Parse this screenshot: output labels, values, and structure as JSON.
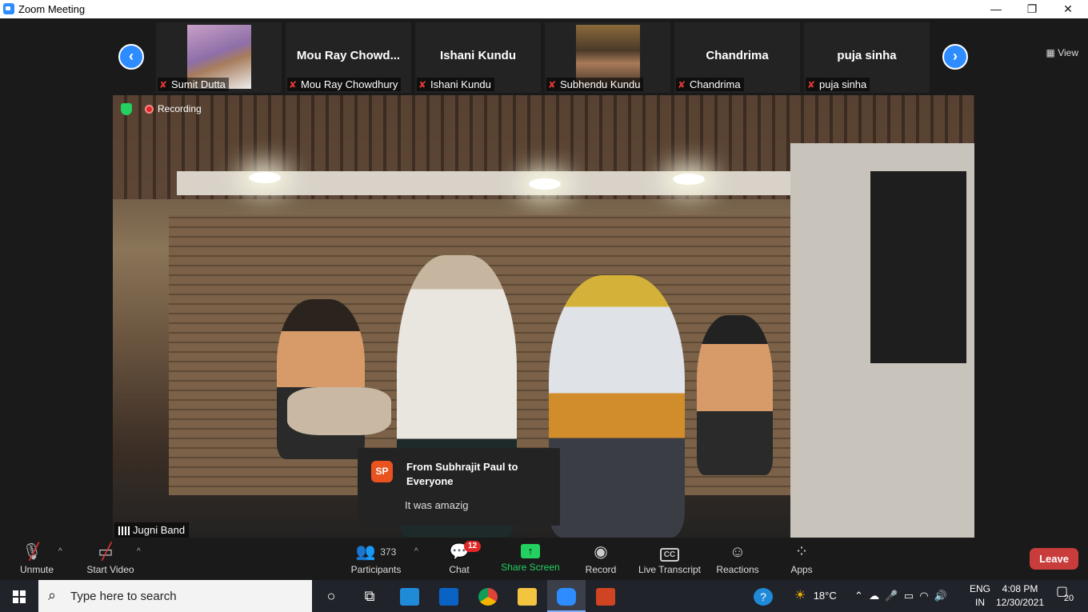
{
  "window": {
    "title": "Zoom Meeting",
    "minimize": "—",
    "restore": "❐",
    "close": "✕"
  },
  "gallery": {
    "prev": "‹",
    "next": "›",
    "view_label": "View",
    "tiles": [
      {
        "big_name": "",
        "label": "Sumit Dutta",
        "has_photo": true
      },
      {
        "big_name": "Mou  Ray  Chowd...",
        "label": "Mou Ray Chowdhury",
        "has_photo": false
      },
      {
        "big_name": "Ishani Kundu",
        "label": "Ishani Kundu",
        "has_photo": false
      },
      {
        "big_name": "",
        "label": "Subhendu Kundu",
        "has_photo": true
      },
      {
        "big_name": "Chandrima",
        "label": "Chandrima",
        "has_photo": false
      },
      {
        "big_name": "puja sinha",
        "label": "puja sinha",
        "has_photo": false
      }
    ]
  },
  "video": {
    "recording_label": "Recording",
    "speaker_name": "Jugni Band"
  },
  "chat_popup": {
    "avatar_initials": "SP",
    "from": "From Subhrajit Paul to Everyone",
    "message": "It was amazig"
  },
  "toolbar": {
    "unmute": "Unmute",
    "start_video": "Start Video",
    "participants": "Participants",
    "participants_count": "373",
    "chat": "Chat",
    "chat_badge": "12",
    "share_screen": "Share Screen",
    "record": "Record",
    "live_transcript": "Live Transcript",
    "reactions": "Reactions",
    "apps": "Apps",
    "leave": "Leave"
  },
  "taskbar": {
    "search_placeholder": "Type here to search",
    "weather_temp": "18°C",
    "lang_top": "ENG",
    "lang_bottom": "IN",
    "time": "4:08 PM",
    "date": "12/30/2021",
    "notification_count": "20"
  },
  "colors": {
    "zoom_blue": "#2D8CFF",
    "leave_red": "#c93c3c",
    "share_green": "#23d160",
    "taskbar": "#20232a"
  }
}
